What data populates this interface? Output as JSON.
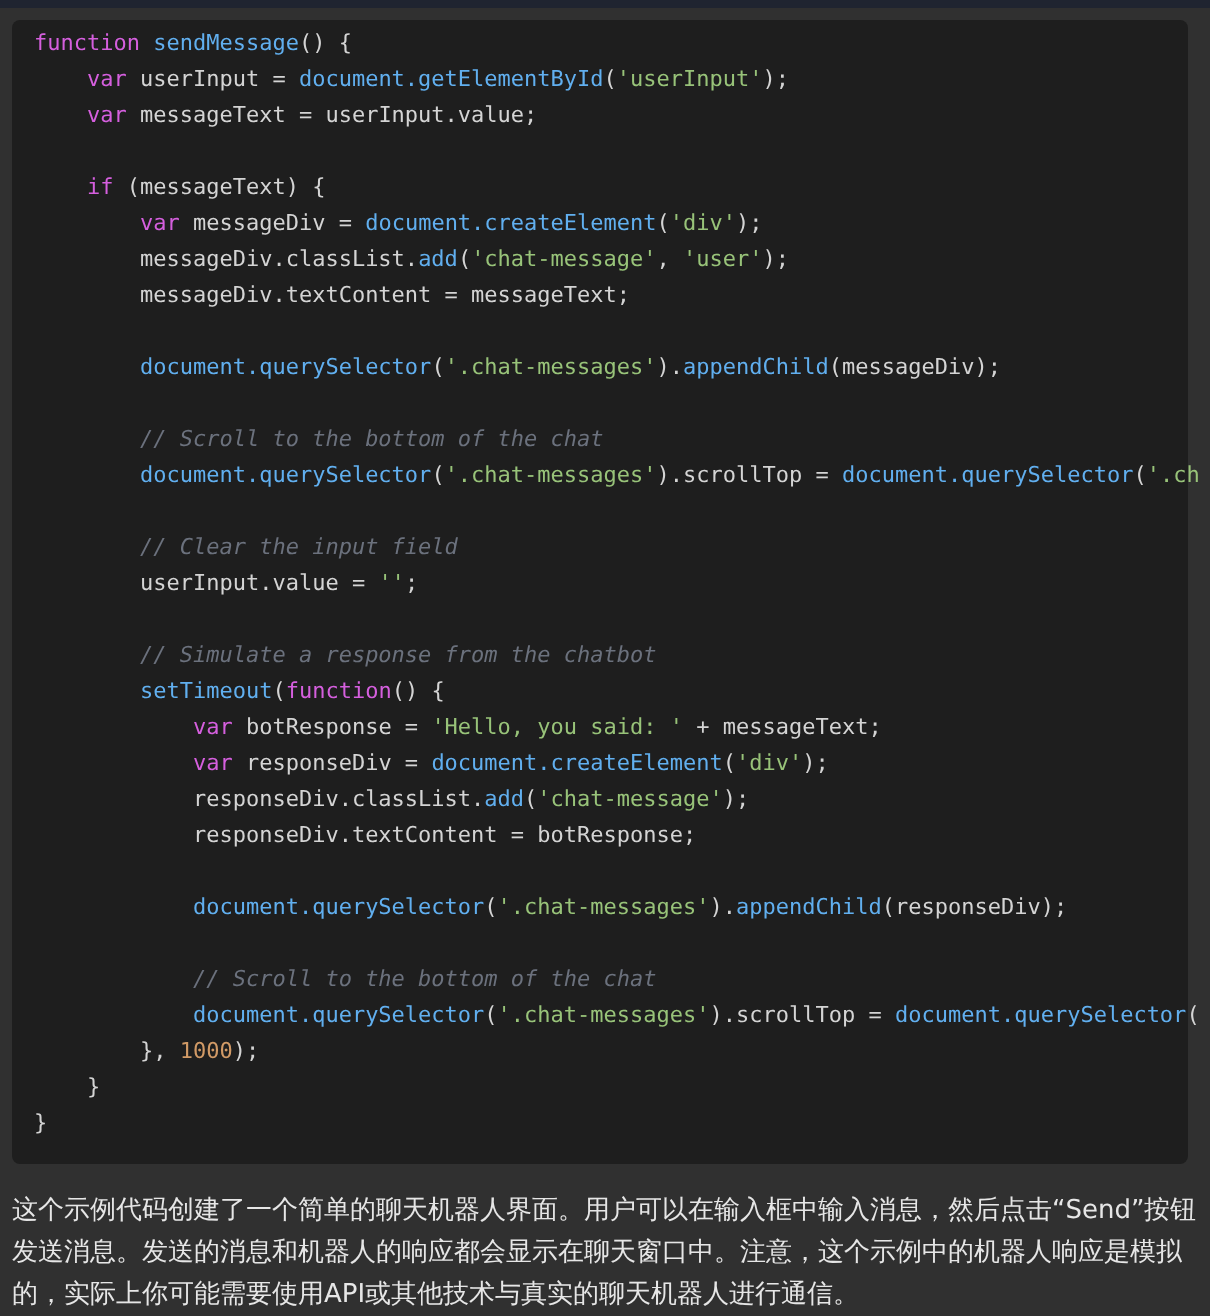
{
  "code_block": {
    "lines": [
      {
        "kind": "code",
        "tokens": [
          {
            "kind": "kw",
            "text": "function "
          },
          {
            "kind": "fn",
            "text": "sendMessage"
          },
          {
            "kind": "txt",
            "text": "() {"
          }
        ]
      },
      {
        "kind": "code",
        "tokens": [
          {
            "kind": "kw",
            "text": "    var"
          },
          {
            "kind": "txt",
            "text": " userInput = "
          },
          {
            "kind": "fn",
            "text": "document.getElementById"
          },
          {
            "kind": "txt",
            "text": "("
          },
          {
            "kind": "str",
            "text": "'userInput'"
          },
          {
            "kind": "txt",
            "text": ");"
          }
        ]
      },
      {
        "kind": "code",
        "tokens": [
          {
            "kind": "kw",
            "text": "    var"
          },
          {
            "kind": "txt",
            "text": " messageText = userInput.value;"
          }
        ]
      },
      {
        "kind": "blank"
      },
      {
        "kind": "code",
        "tokens": [
          {
            "kind": "kw",
            "text": "    if"
          },
          {
            "kind": "txt",
            "text": " (messageText) {"
          }
        ]
      },
      {
        "kind": "code",
        "tokens": [
          {
            "kind": "kw",
            "text": "        var"
          },
          {
            "kind": "txt",
            "text": " messageDiv = "
          },
          {
            "kind": "fn",
            "text": "document.createElement"
          },
          {
            "kind": "txt",
            "text": "("
          },
          {
            "kind": "str",
            "text": "'div'"
          },
          {
            "kind": "txt",
            "text": ");"
          }
        ]
      },
      {
        "kind": "code",
        "tokens": [
          {
            "kind": "txt",
            "text": "        messageDiv.classList."
          },
          {
            "kind": "fn",
            "text": "add"
          },
          {
            "kind": "txt",
            "text": "("
          },
          {
            "kind": "str",
            "text": "'chat-message'"
          },
          {
            "kind": "txt",
            "text": ", "
          },
          {
            "kind": "str",
            "text": "'user'"
          },
          {
            "kind": "txt",
            "text": ");"
          }
        ]
      },
      {
        "kind": "code",
        "tokens": [
          {
            "kind": "txt",
            "text": "        messageDiv.textContent = messageText;"
          }
        ]
      },
      {
        "kind": "blank"
      },
      {
        "kind": "code",
        "tokens": [
          {
            "kind": "fn",
            "text": "        document.querySelector"
          },
          {
            "kind": "txt",
            "text": "("
          },
          {
            "kind": "str",
            "text": "'.chat-messages'"
          },
          {
            "kind": "txt",
            "text": ")."
          },
          {
            "kind": "fn",
            "text": "appendChild"
          },
          {
            "kind": "txt",
            "text": "(messageDiv);"
          }
        ]
      },
      {
        "kind": "blank"
      },
      {
        "kind": "code",
        "tokens": [
          {
            "kind": "cmt",
            "text": "        // Scroll to the bottom of the chat"
          }
        ]
      },
      {
        "kind": "code",
        "tokens": [
          {
            "kind": "fn",
            "text": "        document.querySelector"
          },
          {
            "kind": "txt",
            "text": "("
          },
          {
            "kind": "str",
            "text": "'.chat-messages'"
          },
          {
            "kind": "txt",
            "text": ").scrollTop = "
          },
          {
            "kind": "fn",
            "text": "document.querySelector"
          },
          {
            "kind": "txt",
            "text": "("
          },
          {
            "kind": "str",
            "text": "'.ch"
          }
        ]
      },
      {
        "kind": "blank"
      },
      {
        "kind": "code",
        "tokens": [
          {
            "kind": "cmt",
            "text": "        // Clear the input field"
          }
        ]
      },
      {
        "kind": "code",
        "tokens": [
          {
            "kind": "txt",
            "text": "        userInput.value = "
          },
          {
            "kind": "str",
            "text": "''"
          },
          {
            "kind": "txt",
            "text": ";"
          }
        ]
      },
      {
        "kind": "blank"
      },
      {
        "kind": "code",
        "tokens": [
          {
            "kind": "cmt",
            "text": "        // Simulate a response from the chatbot"
          }
        ]
      },
      {
        "kind": "code",
        "tokens": [
          {
            "kind": "fn",
            "text": "        setTimeout"
          },
          {
            "kind": "txt",
            "text": "("
          },
          {
            "kind": "kw",
            "text": "function"
          },
          {
            "kind": "txt",
            "text": "() {"
          }
        ]
      },
      {
        "kind": "code",
        "tokens": [
          {
            "kind": "kw",
            "text": "            var"
          },
          {
            "kind": "txt",
            "text": " botResponse = "
          },
          {
            "kind": "str",
            "text": "'Hello, you said: '"
          },
          {
            "kind": "txt",
            "text": " + messageText;"
          }
        ]
      },
      {
        "kind": "code",
        "tokens": [
          {
            "kind": "kw",
            "text": "            var"
          },
          {
            "kind": "txt",
            "text": " responseDiv = "
          },
          {
            "kind": "fn",
            "text": "document.createElement"
          },
          {
            "kind": "txt",
            "text": "("
          },
          {
            "kind": "str",
            "text": "'div'"
          },
          {
            "kind": "txt",
            "text": ");"
          }
        ]
      },
      {
        "kind": "code",
        "tokens": [
          {
            "kind": "txt",
            "text": "            responseDiv.classList."
          },
          {
            "kind": "fn",
            "text": "add"
          },
          {
            "kind": "txt",
            "text": "("
          },
          {
            "kind": "str",
            "text": "'chat-message'"
          },
          {
            "kind": "txt",
            "text": ");"
          }
        ]
      },
      {
        "kind": "code",
        "tokens": [
          {
            "kind": "txt",
            "text": "            responseDiv.textContent = botResponse;"
          }
        ]
      },
      {
        "kind": "blank"
      },
      {
        "kind": "code",
        "tokens": [
          {
            "kind": "fn",
            "text": "            document.querySelector"
          },
          {
            "kind": "txt",
            "text": "("
          },
          {
            "kind": "str",
            "text": "'.chat-messages'"
          },
          {
            "kind": "txt",
            "text": ")."
          },
          {
            "kind": "fn",
            "text": "appendChild"
          },
          {
            "kind": "txt",
            "text": "(responseDiv);"
          }
        ]
      },
      {
        "kind": "blank"
      },
      {
        "kind": "code",
        "tokens": [
          {
            "kind": "cmt",
            "text": "            // Scroll to the bottom of the chat"
          }
        ]
      },
      {
        "kind": "code",
        "tokens": [
          {
            "kind": "fn",
            "text": "            document.querySelector"
          },
          {
            "kind": "txt",
            "text": "("
          },
          {
            "kind": "str",
            "text": "'.chat-messages'"
          },
          {
            "kind": "txt",
            "text": ").scrollTop = "
          },
          {
            "kind": "fn",
            "text": "document.querySelector"
          },
          {
            "kind": "txt",
            "text": "("
          }
        ]
      },
      {
        "kind": "code",
        "tokens": [
          {
            "kind": "txt",
            "text": "        }, "
          },
          {
            "kind": "num",
            "text": "1000"
          },
          {
            "kind": "txt",
            "text": ");"
          }
        ]
      },
      {
        "kind": "code",
        "tokens": [
          {
            "kind": "txt",
            "text": "    }"
          }
        ]
      },
      {
        "kind": "code",
        "tokens": [
          {
            "kind": "txt",
            "text": "}"
          }
        ]
      }
    ]
  },
  "explanation": "这个示例代码创建了一个简单的聊天机器人界面。用户可以在输入框中输入消息，然后点击“Send”按钮发送消息。发送的消息和机器人的响应都会显示在聊天窗口中。注意，这个示例中的机器人响应是模拟的，实际上你可能需要使用API或其他技术与真实的聊天机器人进行通信。"
}
